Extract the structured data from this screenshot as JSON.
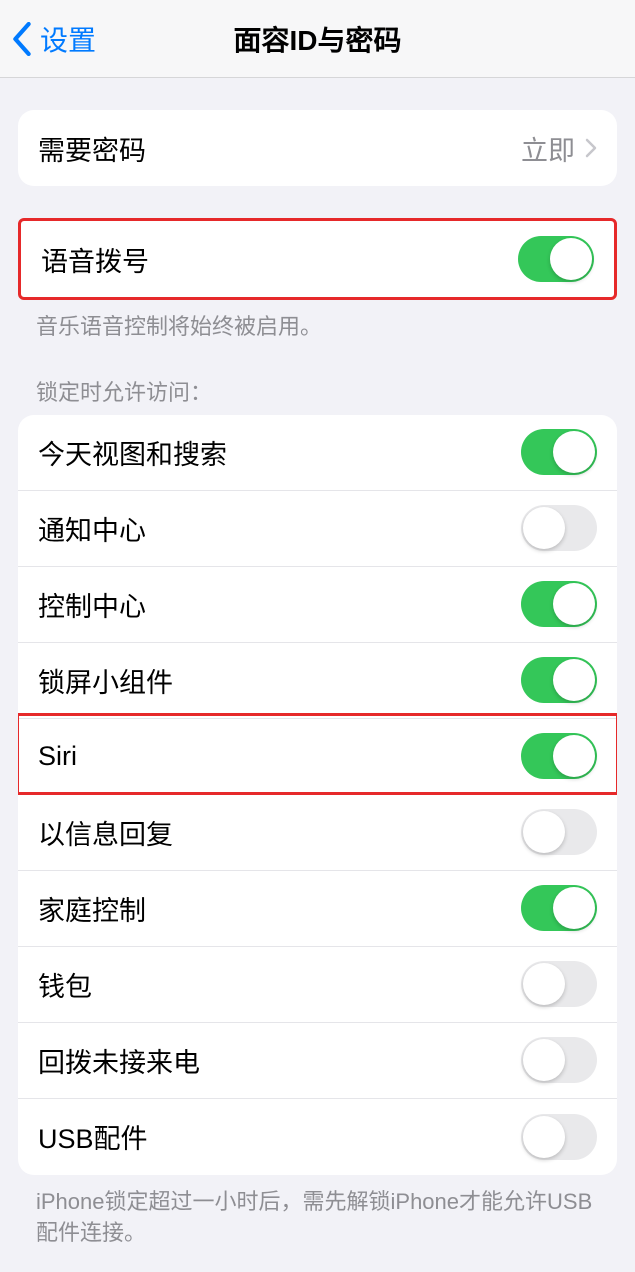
{
  "header": {
    "back_label": "设置",
    "title": "面容ID与密码"
  },
  "passcode_group": {
    "require_label": "需要密码",
    "require_value": "立即"
  },
  "voice_dial": {
    "label": "语音拨号",
    "on": true,
    "footer": "音乐语音控制将始终被启用。"
  },
  "lock_access": {
    "header": "锁定时允许访问：",
    "items": [
      {
        "label": "今天视图和搜索",
        "on": true
      },
      {
        "label": "通知中心",
        "on": false
      },
      {
        "label": "控制中心",
        "on": true
      },
      {
        "label": "锁屏小组件",
        "on": true
      },
      {
        "label": "Siri",
        "on": true
      },
      {
        "label": "以信息回复",
        "on": false
      },
      {
        "label": "家庭控制",
        "on": true
      },
      {
        "label": "钱包",
        "on": false
      },
      {
        "label": "回拨未接来电",
        "on": false
      },
      {
        "label": "USB配件",
        "on": false
      }
    ],
    "footer": "iPhone锁定超过一小时后，需先解锁iPhone才能允许USB配件连接。"
  }
}
